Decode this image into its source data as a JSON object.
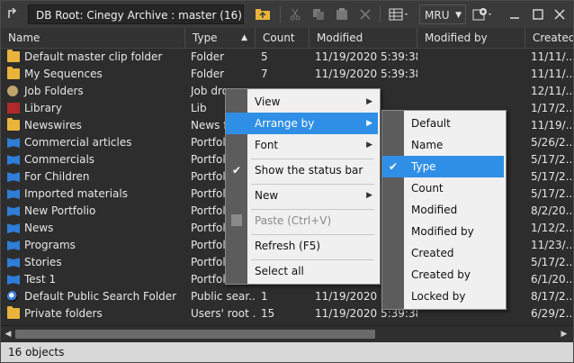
{
  "toolbar": {
    "path": "DB Root: Cinegy Archive : master (16)",
    "mru_label": "MRU"
  },
  "columns": [
    "Name",
    "Type",
    "Count",
    "Modified",
    "Modified by",
    "Created"
  ],
  "rows": [
    {
      "icon": "folder-icon",
      "name": "Default master clip folder",
      "type": "Folder",
      "count": "5",
      "modified": "11/19/2020 5:39:38...",
      "modified_by": "",
      "created": "11/11/..."
    },
    {
      "icon": "folder-icon",
      "name": "My Sequences",
      "type": "Folder",
      "count": "7",
      "modified": "11/19/2020 5:39:38...",
      "modified_by": "",
      "created": "11/11/..."
    },
    {
      "icon": "job-folder-icon",
      "name": "Job Folders",
      "type": "Job drop...",
      "count": "",
      "modified": "",
      "modified_by": "",
      "created": "12/11/..."
    },
    {
      "icon": "library-icon",
      "name": "Library",
      "type": "Lib",
      "count": "",
      "modified": "",
      "modified_by": "",
      "created": "1/17/2..."
    },
    {
      "icon": "folder-icon",
      "name": "Newswires",
      "type": "News fo...",
      "count": "",
      "modified": "",
      "modified_by": "",
      "created": "11/19/..."
    },
    {
      "icon": "book-icon",
      "name": "Commercial articles",
      "type": "Portfoli...",
      "count": "",
      "modified": "",
      "modified_by": "",
      "created": "5/26/2..."
    },
    {
      "icon": "book-icon",
      "name": "Commercials",
      "type": "Portfoli...",
      "count": "",
      "modified": "",
      "modified_by": "...e...",
      "created": "5/17/2..."
    },
    {
      "icon": "book-icon",
      "name": "For Children",
      "type": "Portfoli...",
      "count": "",
      "modified": "",
      "modified_by": "...e...",
      "created": "5/17/2..."
    },
    {
      "icon": "book-icon",
      "name": "Imported materials",
      "type": "Portfoli...",
      "count": "",
      "modified": "",
      "modified_by": "",
      "created": "5/17/2..."
    },
    {
      "icon": "book-icon",
      "name": "New Portfolio",
      "type": "Portfoli...",
      "count": "",
      "modified": "",
      "modified_by": "",
      "created": "8/2/20..."
    },
    {
      "icon": "book-icon",
      "name": "News",
      "type": "Portfoli...",
      "count": "",
      "modified": "",
      "modified_by": "",
      "created": "1/12/2..."
    },
    {
      "icon": "book-icon",
      "name": "Programs",
      "type": "Portfoli...",
      "count": "",
      "modified": "",
      "modified_by": "",
      "created": "11/23/..."
    },
    {
      "icon": "book-icon",
      "name": "Stories",
      "type": "Portfoli...",
      "count": "",
      "modified": "",
      "modified_by": "...e...",
      "created": "5/17/2..."
    },
    {
      "icon": "book-icon",
      "name": "Test 1",
      "type": "Portfoli...",
      "count": "",
      "modified": "",
      "modified_by": "",
      "created": "6/1/20..."
    },
    {
      "icon": "globe-icon",
      "name": "Default Public Search Folder",
      "type": "Public sear...",
      "count": "1",
      "modified": "11/19/2020 5:39:38...",
      "modified_by": "",
      "created": "8/17/2..."
    },
    {
      "icon": "folder-icon",
      "name": "Private folders",
      "type": "Users' root ...",
      "count": "15",
      "modified": "11/19/2020 5:39:38...",
      "modified_by": "",
      "created": "6/29/2..."
    }
  ],
  "status": "16 objects",
  "context_menu": {
    "view": "View",
    "arrange_by": "Arrange by",
    "font": "Font",
    "show_status_bar": "Show the status bar",
    "new": "New",
    "paste": "Paste (Ctrl+V)",
    "refresh": "Refresh (F5)",
    "select_all": "Select all"
  },
  "arrange_menu": {
    "items": [
      "Default",
      "Name",
      "Type",
      "Count",
      "Modified",
      "Modified by",
      "Created",
      "Created by",
      "Locked by"
    ],
    "checked": "Type"
  },
  "colors": {
    "accent": "#2f8fe6",
    "folder": "#e8b43c",
    "portfolio": "#2e7dd6"
  }
}
